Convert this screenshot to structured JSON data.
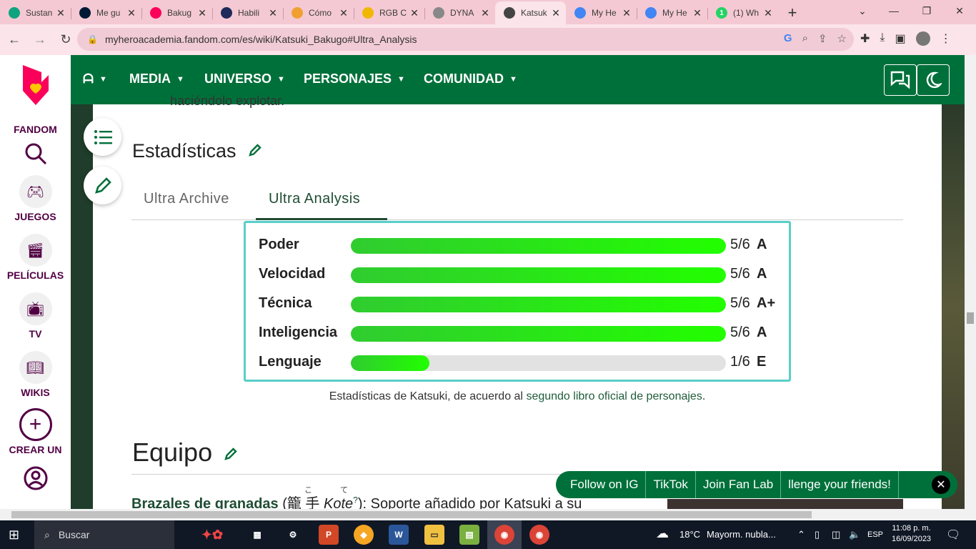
{
  "browser": {
    "tabs": [
      {
        "title": "Sustan",
        "favicon": "openai-icon",
        "color": "#10a37f"
      },
      {
        "title": "Me gu",
        "favicon": "tumblr-icon",
        "color": "#001935"
      },
      {
        "title": "Bakug",
        "favicon": "fandom-icon",
        "color": "#fa005a"
      },
      {
        "title": "Habili",
        "favicon": "anime-planet-icon",
        "color": "#1e2a5a"
      },
      {
        "title": "Cómo",
        "favicon": "blog-icon",
        "color": "#f0a030"
      },
      {
        "title": "RGB C",
        "favicon": "rockstar-icon",
        "color": "#f2b705"
      },
      {
        "title": "DYNA",
        "favicon": "character-icon",
        "color": "#888888"
      },
      {
        "title": "Katsuk",
        "favicon": "character-icon",
        "color": "#444444",
        "active": true
      },
      {
        "title": "My He",
        "favicon": "google-icon",
        "color": "#4285f4"
      },
      {
        "title": "My He",
        "favicon": "google-icon",
        "color": "#4285f4"
      },
      {
        "title": "(1) Wh",
        "favicon": "whatsapp-icon",
        "color": "#25d366",
        "badge": "1"
      }
    ],
    "url": "myheroacademia.fandom.com/es/wiki/Katsuki_Bakugo#Ultra_Analysis"
  },
  "rail": {
    "logo_text": "FANDOM",
    "items": [
      {
        "label": "JUEGOS",
        "icon": "gamepad-icon"
      },
      {
        "label": "PELÍCULAS",
        "icon": "clapperboard-icon"
      },
      {
        "label": "TV",
        "icon": "tv-icon"
      },
      {
        "label": "WIKIS",
        "icon": "book-icon"
      },
      {
        "label": "CREAR UN",
        "icon": "plus-circle-icon"
      }
    ]
  },
  "nav": {
    "items": [
      "MEDIA",
      "UNIVERSO",
      "PERSONAJES",
      "COMUNIDAD"
    ]
  },
  "article": {
    "cutoff_text": "haciéndolo explotar.",
    "stats_heading": "Estadísticas",
    "tabs": [
      "Ultra Archive",
      "Ultra Analysis"
    ],
    "active_tab": "Ultra Analysis",
    "stats": [
      {
        "label": "Poder",
        "score": "5/6",
        "grade": "A",
        "fraction": 0.9999
      },
      {
        "label": "Velocidad",
        "score": "5/6",
        "grade": "A",
        "fraction": 0.9999
      },
      {
        "label": "Técnica",
        "score": "5/6",
        "grade": "A+",
        "fraction": 0.9999
      },
      {
        "label": "Inteligencia",
        "score": "5/6",
        "grade": "A",
        "fraction": 0.9999
      },
      {
        "label": "Lenguaje",
        "score": "1/6",
        "grade": "E",
        "fraction": 0.2095
      }
    ],
    "caption_before": "Estadísticas de Katsuki, de acuerdo al ",
    "caption_link": "segundo libro oficial de personajes",
    "caption_after": ".",
    "equipo_heading": "Equipo",
    "para_link": "Brazales de granadas",
    "para_kanji": "(籠 手",
    "para_ruby": "こ て",
    "para_romaji": "Kote",
    "para_ref": "?",
    "para_rest": "): Soporte añadido por Katsuki a su"
  },
  "social": {
    "links": [
      "Follow on IG",
      "TikTok",
      "Join Fan Lab",
      "llenge your friends!"
    ]
  },
  "taskbar": {
    "search_placeholder": "Buscar",
    "weather": "18°C",
    "weather_text": "Mayorm. nubla...",
    "lang": "ESP",
    "time": "11:08 p. m.",
    "date": "16/09/2023"
  }
}
